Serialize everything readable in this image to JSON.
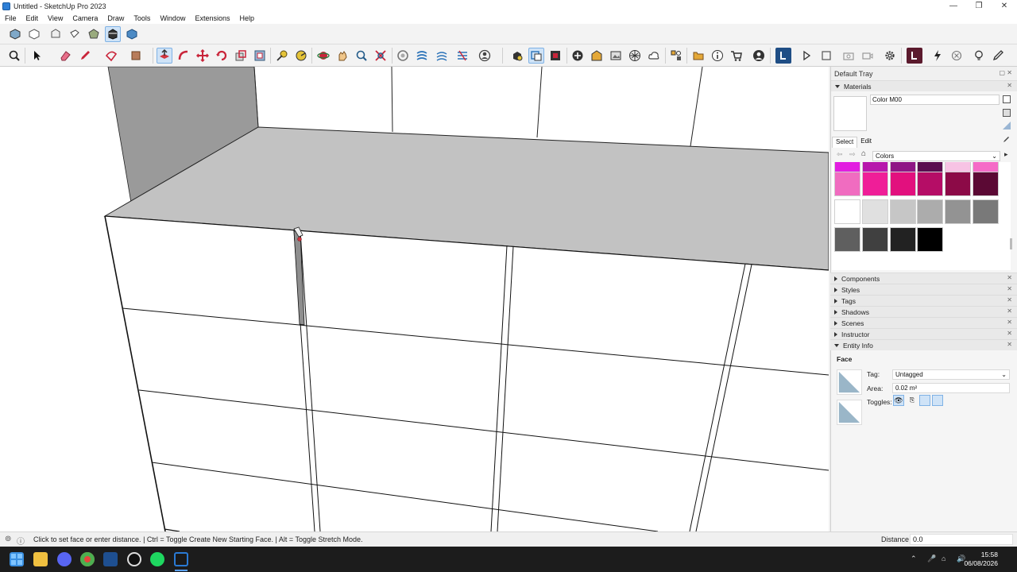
{
  "window": {
    "title": "Untitled - SketchUp Pro 2023",
    "controls": [
      "—",
      "❐",
      "✕"
    ]
  },
  "menu": [
    "File",
    "Edit",
    "View",
    "Camera",
    "Draw",
    "Tools",
    "Window",
    "Extensions",
    "Help"
  ],
  "tray": {
    "title": "Default Tray",
    "materials": {
      "header": "Materials",
      "name": "Color M00",
      "tabs": [
        "Select",
        "Edit"
      ],
      "library": "Colors",
      "swatch_colors": [
        [
          "#e21ee0",
          "#b718ac",
          "#8f1685",
          "#5a0d4f",
          "#f7c3e4",
          "#f56bc7"
        ],
        [
          "#f06cc0",
          "#ef1e98",
          "#e2107e",
          "#b50d66",
          "#8c0a47",
          "#5b0934"
        ],
        [
          "#ffffff",
          "#e0e0e0",
          "#c6c6c6",
          "#acacac",
          "#939393",
          "#797979"
        ],
        [
          "#5f5f5f",
          "#404040",
          "#222222",
          "#000000"
        ]
      ]
    },
    "panels": [
      "Components",
      "Styles",
      "Tags",
      "Shadows",
      "Scenes",
      "Instructor",
      "Entity Info"
    ],
    "entity_info": {
      "type": "Face",
      "tag_label": "Tag:",
      "tag_value": "Untagged",
      "area_label": "Area:",
      "area_value": "0.02 m²",
      "toggles_label": "Toggles:"
    }
  },
  "status": {
    "message": "Click to set face or enter distance. | Ctrl = Toggle Create New Starting Face. | Alt = Toggle Stretch Mode.",
    "distance_label": "Distance",
    "distance_value": "0.0"
  },
  "clock": {
    "time": "15:58",
    "date": "06/08/2026"
  },
  "icons": {
    "toolbar1": [
      "iso-view-icon",
      "top-view-icon",
      "front-view-icon",
      "right-view-icon",
      "back-view-icon",
      "left-view-icon",
      "bottom-view-icon"
    ],
    "toolbar2": [
      "zoom-icon",
      "select-icon",
      "eraser-icon",
      "pencil-icon",
      "shapes-icon",
      "paint-bucket-icon",
      "push-pull-icon",
      "follow-me-icon",
      "move-icon",
      "rotate-icon",
      "scale-icon",
      "offset-icon",
      "tape-measure-icon",
      "protractor-icon",
      "orbit-icon",
      "pan-icon",
      "zoom-window-icon",
      "zoom-extents-icon"
    ]
  }
}
